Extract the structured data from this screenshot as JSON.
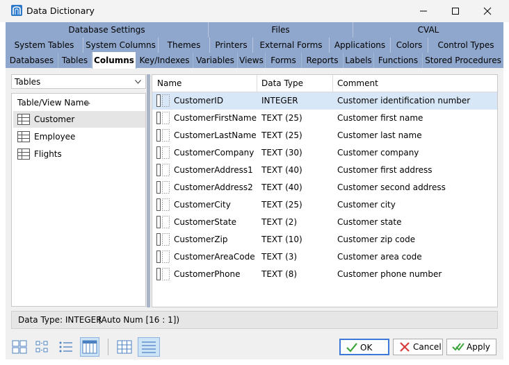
{
  "window": {
    "title": "Data Dictionary"
  },
  "tabs": {
    "row1": [
      "Database Settings",
      "Files",
      "CVAL"
    ],
    "row2": [
      "System Tables",
      "System Columns",
      "Themes",
      "Printers",
      "External Forms",
      "Applications",
      "Colors",
      "Control Types"
    ],
    "row3": [
      "Databases",
      "Tables",
      "Columns",
      "Key/Indexes",
      "Variables",
      "Views",
      "Forms",
      "Reports",
      "Labels",
      "Functions",
      "Stored Procedures"
    ],
    "active": "Columns"
  },
  "left_panel": {
    "dropdown_value": "Tables",
    "header": "Table/View Name",
    "items": [
      "Customer",
      "Employee",
      "Flights"
    ],
    "selected": "Customer"
  },
  "grid": {
    "columns": [
      "Name",
      "Data Type",
      "Comment"
    ],
    "rows": [
      [
        "CustomerID",
        "INTEGER",
        "Customer identification number"
      ],
      [
        "CustomerFirstName",
        "TEXT (25)",
        "Customer first name"
      ],
      [
        "CustomerLastName",
        "TEXT (25)",
        "Customer last name"
      ],
      [
        "CustomerCompany",
        "TEXT (30)",
        "Customer company"
      ],
      [
        "CustomerAddress1",
        "TEXT (40)",
        "Customer first address"
      ],
      [
        "CustomerAddress2",
        "TEXT (40)",
        "Customer second address"
      ],
      [
        "CustomerCity",
        "TEXT (25)",
        "Customer city"
      ],
      [
        "CustomerState",
        "TEXT (2)",
        "Customer state"
      ],
      [
        "CustomerZip",
        "TEXT (10)",
        "Customer zip code"
      ],
      [
        "CustomerAreaCode",
        "TEXT (3)",
        "Customer area code"
      ],
      [
        "CustomerPhone",
        "TEXT (8)",
        "Customer phone number"
      ]
    ]
  },
  "status": {
    "data_type": "Data Type: INTEGER",
    "detail": "(Auto Num [16 : 1])"
  },
  "buttons": {
    "ok": "OK",
    "cancel": "Cancel",
    "apply": "Apply"
  },
  "colors": {
    "tab_band": "#8fa7cc",
    "selection": "#d8e7f7",
    "ok_border": "#3c78d8",
    "cancel_x": "#d83b3b",
    "check_green": "#3ca53c"
  },
  "icons": [
    "app-icon",
    "minimize-icon",
    "maximize-icon",
    "close-icon",
    "chevron-down-icon",
    "sort-up-icon",
    "table-icon",
    "field-icon",
    "large-icons-view-icon",
    "small-icons-view-icon",
    "list-view-icon",
    "details-view-icon",
    "grid-lines-icon",
    "row-lines-icon",
    "checkmark-icon",
    "cancel-x-icon",
    "apply-check-icon"
  ]
}
